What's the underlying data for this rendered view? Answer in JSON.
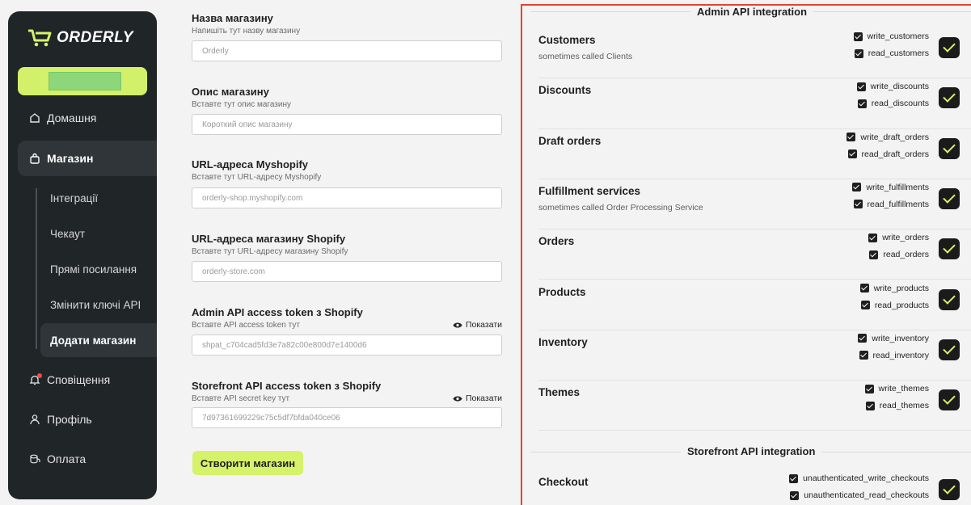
{
  "sidebar": {
    "logo_text": "ORDERLY",
    "nav": {
      "home": "Домашня",
      "store": "Магазин",
      "notifications": "Сповіщення",
      "profile": "Профіль",
      "payment": "Оплата"
    },
    "sub": {
      "integrations": "Інтеграції",
      "checkout": "Чекаут",
      "direct_links": "Прямі посилання",
      "change_api_keys": "Змінити ключі API",
      "add_store": "Додати магазин"
    }
  },
  "form": {
    "fields": [
      {
        "label": "Назва магазину",
        "hint": "Напишіть тут назву магазину",
        "value": "Orderly"
      },
      {
        "label": "Опис магазину",
        "hint": "Вставте тут опис магазину",
        "value": "Короткий опис магазину"
      },
      {
        "label": "URL-адреса Myshopify",
        "hint": "Вставте тут URL-адресу Myshopify",
        "value": "orderly-shop.myshopify.com"
      },
      {
        "label": "URL-адреса магазину Shopify",
        "hint": "Вставте тут URL-адресу магазину Shopify",
        "value": "orderly-store.com"
      },
      {
        "label": "Admin API access token з Shopify",
        "hint": "Вставте API access token тут",
        "value": "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",
        "toggle": "Показати"
      },
      {
        "label": "Storefront API access token з Shopify",
        "hint": "Вставте API secret key тут",
        "value": "7d97361699229c75c5df7bfda040ce06",
        "toggle": "Показати"
      }
    ],
    "create_button": "Створити магазин"
  },
  "panel": {
    "admin_title": "Admin API integration",
    "storefront_title": "Storefront API integration",
    "admin": [
      {
        "name": "Customers",
        "sub": "sometimes called Clients",
        "scopes": [
          "write_customers",
          "read_customers"
        ]
      },
      {
        "name": "Discounts",
        "sub": "",
        "scopes": [
          "write_discounts",
          "read_discounts"
        ]
      },
      {
        "name": "Draft orders",
        "sub": "",
        "scopes": [
          "write_draft_orders",
          "read_draft_orders"
        ]
      },
      {
        "name": "Fulfillment services",
        "sub": "sometimes called Order Processing Service",
        "scopes": [
          "write_fulfillments",
          "read_fulfillments"
        ]
      },
      {
        "name": "Orders",
        "sub": "",
        "scopes": [
          "write_orders",
          "read_orders"
        ]
      },
      {
        "name": "Products",
        "sub": "",
        "scopes": [
          "write_products",
          "read_products"
        ]
      },
      {
        "name": "Inventory",
        "sub": "",
        "scopes": [
          "write_inventory",
          "read_inventory"
        ]
      },
      {
        "name": "Themes",
        "sub": "",
        "scopes": [
          "write_themes",
          "read_themes"
        ]
      }
    ],
    "storefront": [
      {
        "name": "Checkout",
        "sub": "",
        "scopes": [
          "unauthenticated_write_checkouts",
          "unauthenticated_read_checkouts"
        ]
      }
    ]
  },
  "colors": {
    "accent": "#d6f26a",
    "sidebar": "#202528",
    "highlight_border": "#e8412f"
  }
}
